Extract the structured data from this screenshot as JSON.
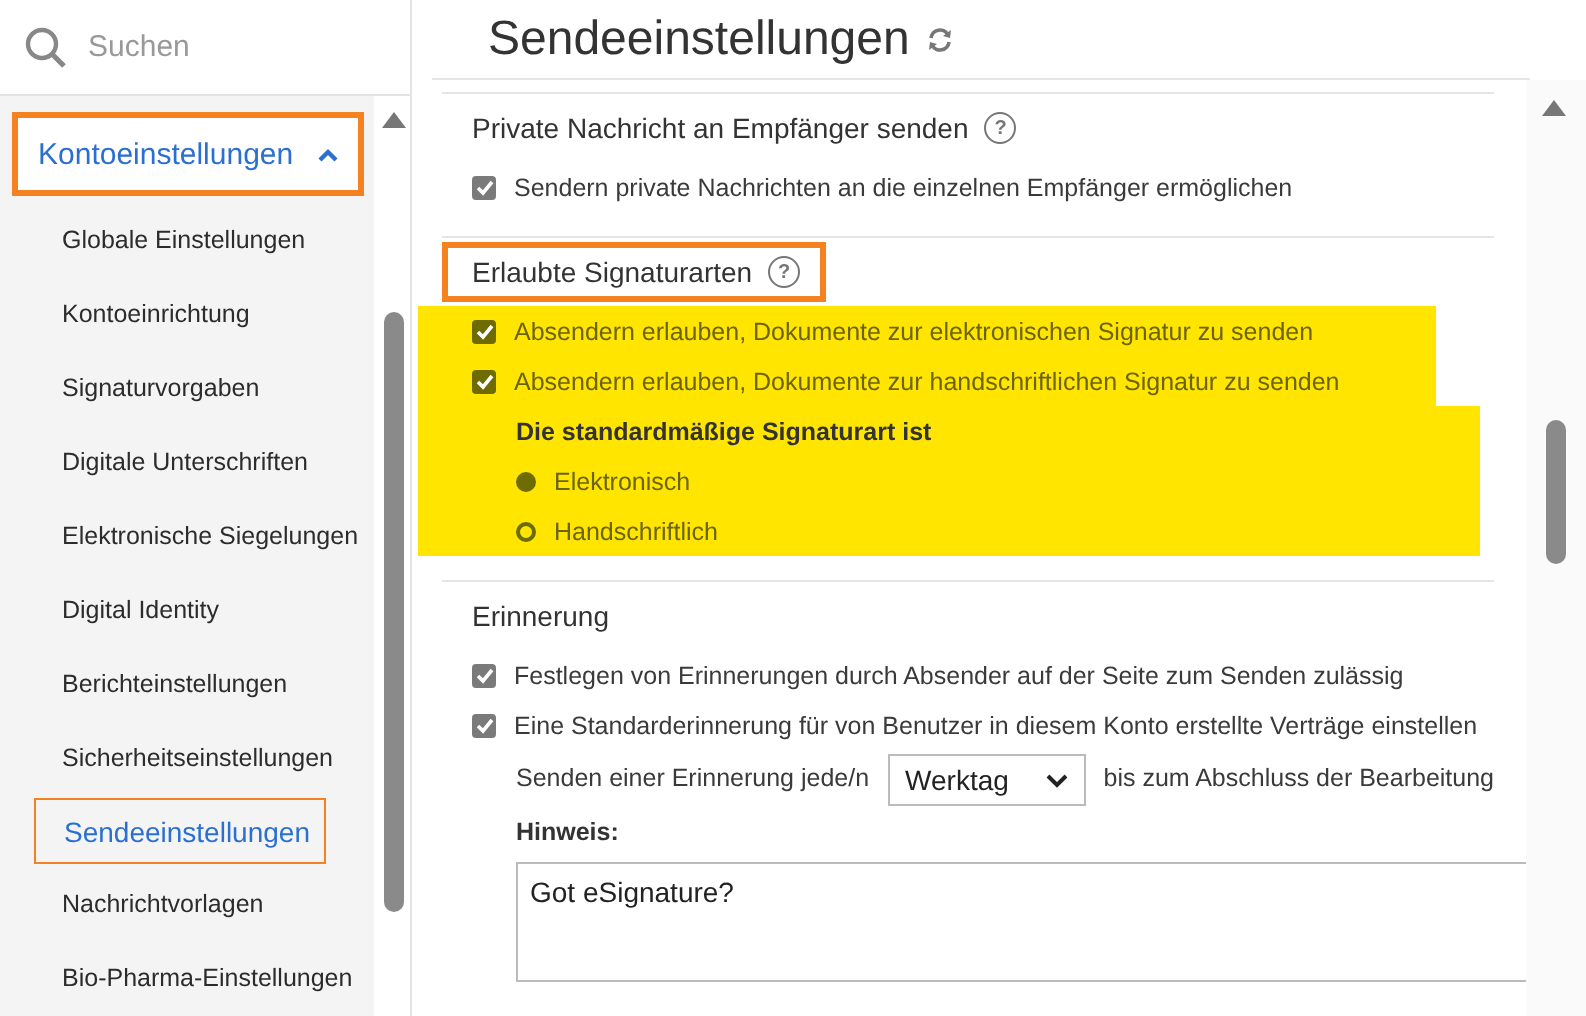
{
  "search": {
    "placeholder": "Suchen"
  },
  "sidebar": {
    "group": {
      "label": "Kontoeinstellungen",
      "expanded": true,
      "annotated": true
    },
    "items": [
      {
        "label": "Globale Einstellungen",
        "selected": false,
        "annotated": false
      },
      {
        "label": "Kontoeinrichtung",
        "selected": false,
        "annotated": false
      },
      {
        "label": "Signaturvorgaben",
        "selected": false,
        "annotated": false
      },
      {
        "label": "Digitale Unterschriften",
        "selected": false,
        "annotated": false
      },
      {
        "label": "Elektronische Siegelungen",
        "selected": false,
        "annotated": false
      },
      {
        "label": "Digital Identity",
        "selected": false,
        "annotated": false
      },
      {
        "label": "Berichteinstellungen",
        "selected": false,
        "annotated": false
      },
      {
        "label": "Sicherheitseinstellungen",
        "selected": false,
        "annotated": false
      },
      {
        "label": "Sendeeinstellungen",
        "selected": true,
        "annotated": true
      },
      {
        "label": "Nachrichtvorlagen",
        "selected": false,
        "annotated": false
      },
      {
        "label": "Bio-Pharma-Einstellungen",
        "selected": false,
        "annotated": false
      }
    ]
  },
  "page": {
    "title": "Sendeeinstellungen"
  },
  "sections": [
    {
      "heading": "Private Nachricht an Empfänger senden",
      "help": "?",
      "annotated": false,
      "rows": [
        {
          "kind": "checkbox",
          "label": "Sendern private Nachrichten an die einzelnen Empfänger ermöglichen",
          "checked": true,
          "highlighted": false
        }
      ]
    },
    {
      "heading": "Erlaubte Signaturarten",
      "help": "?",
      "annotated": true,
      "rows": [
        {
          "kind": "checkbox",
          "label": "Absendern erlauben, Dokumente zur elektronischen Signatur zu senden",
          "checked": true,
          "highlighted": true
        },
        {
          "kind": "checkbox",
          "label": "Absendern erlauben, Dokumente zur handschriftlichen Signatur zu senden",
          "checked": true,
          "highlighted": true
        },
        {
          "kind": "label",
          "label": "Die standardmäßige Signaturart ist",
          "highlighted": true
        },
        {
          "kind": "radio",
          "label": "Elektronisch",
          "selected": true,
          "highlighted": true
        },
        {
          "kind": "radio",
          "label": "Handschriftlich",
          "selected": false,
          "highlighted": true
        }
      ]
    },
    {
      "heading": "Erinnerung",
      "annotated": false,
      "rows": [
        {
          "kind": "checkbox",
          "label": "Festlegen von Erinnerungen durch Absender auf der Seite zum Senden zulässig",
          "checked": true,
          "highlighted": false
        },
        {
          "kind": "checkbox",
          "label": "Eine Standarderinnerung für von Benutzer in diesem Konto erstellte Verträge einstellen",
          "checked": true,
          "highlighted": false
        },
        {
          "kind": "interval",
          "label": "Senden einer Erinnerung jede/n",
          "value": "Werktag",
          "suffix": "bis zum Abschluss der Bearbeitung",
          "highlighted": false
        },
        {
          "kind": "note",
          "label": "Hinweis:",
          "value": "Got eSignature?",
          "highlighted": false
        }
      ]
    }
  ]
}
